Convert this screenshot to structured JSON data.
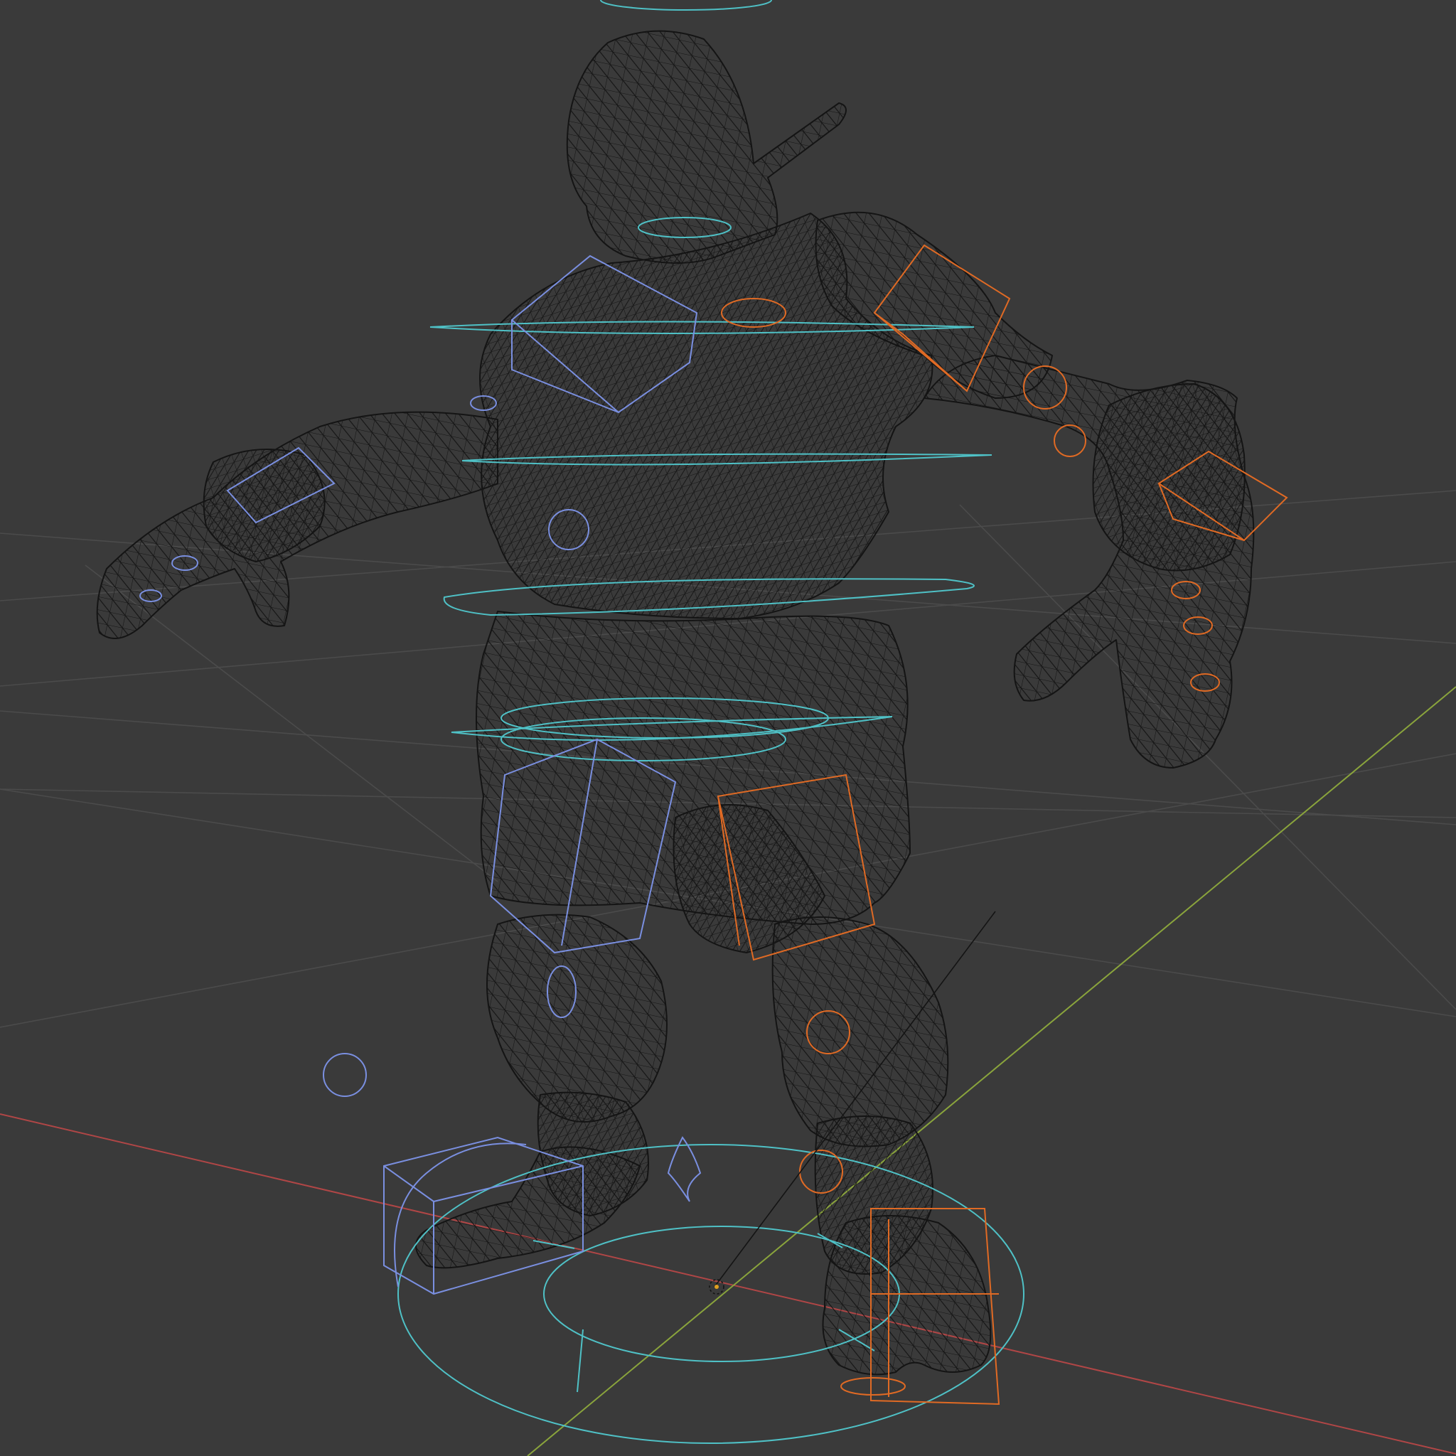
{
  "viewport": {
    "view_mode": "wireframe",
    "background_color": "#3a3a3a",
    "grid_color": "#4a4a4a",
    "mesh_wire_color": "#141414",
    "x_axis_color": "#b04646",
    "y_axis_color": "#8aa43c",
    "cyan_control_color": "#4fc1c6",
    "blue_control_color": "#7a8fe0",
    "orange_control_color": "#e06a24",
    "icons": [
      "3d-cursor-icon",
      "light-icon",
      "empty-sphere-icon"
    ]
  }
}
